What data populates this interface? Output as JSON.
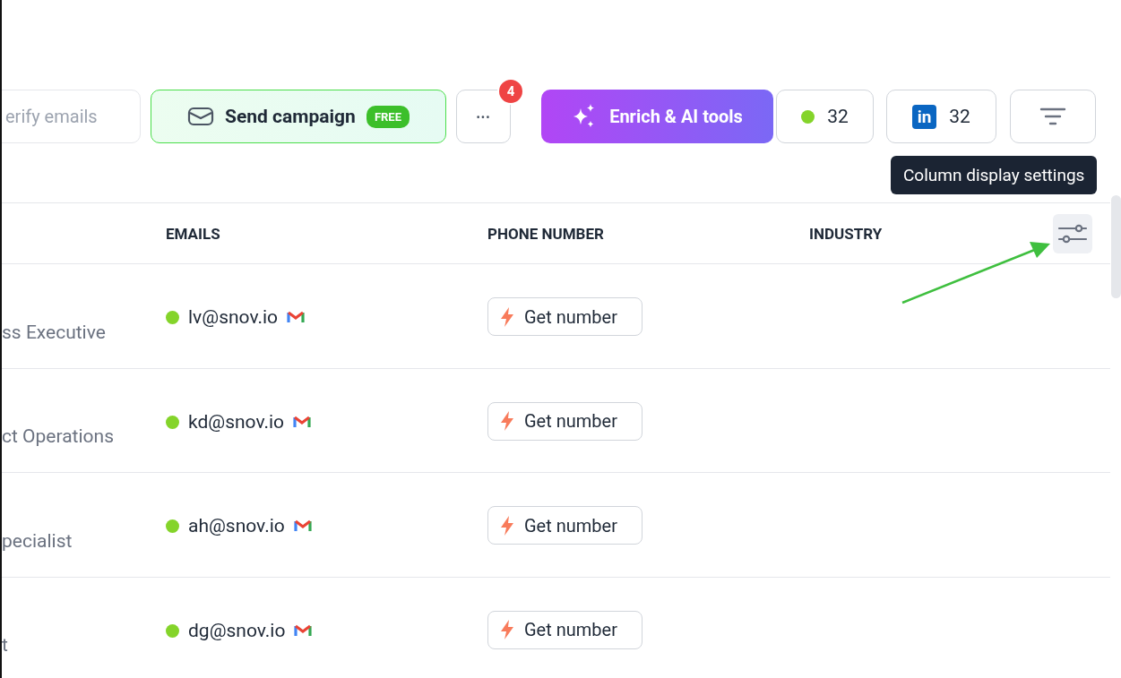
{
  "toolbar": {
    "verify": {
      "label": "erify emails"
    },
    "campaign": {
      "label": "Send campaign",
      "badge": "FREE"
    },
    "more": {
      "label": "•••",
      "count": "4"
    },
    "enrich": {
      "label": "Enrich & AI tools"
    },
    "email_count": {
      "label": "32"
    },
    "linkedin_count": {
      "logo": "in",
      "label": "32"
    }
  },
  "tooltip": "Column display settings",
  "table": {
    "columns": [
      "EMAILS",
      "PHONE NUMBER",
      "INDUSTRY"
    ],
    "rows": [
      {
        "title": "ss Executive",
        "email": "lv@snov.io",
        "phone_button": "Get number"
      },
      {
        "title": "ct Operations",
        "email": "kd@snov.io",
        "phone_button": "Get number"
      },
      {
        "title": "pecialist",
        "email": "ah@snov.io",
        "phone_button": "Get number"
      },
      {
        "title": "t",
        "email": "dg@snov.io",
        "phone_button": "Get number"
      }
    ]
  }
}
